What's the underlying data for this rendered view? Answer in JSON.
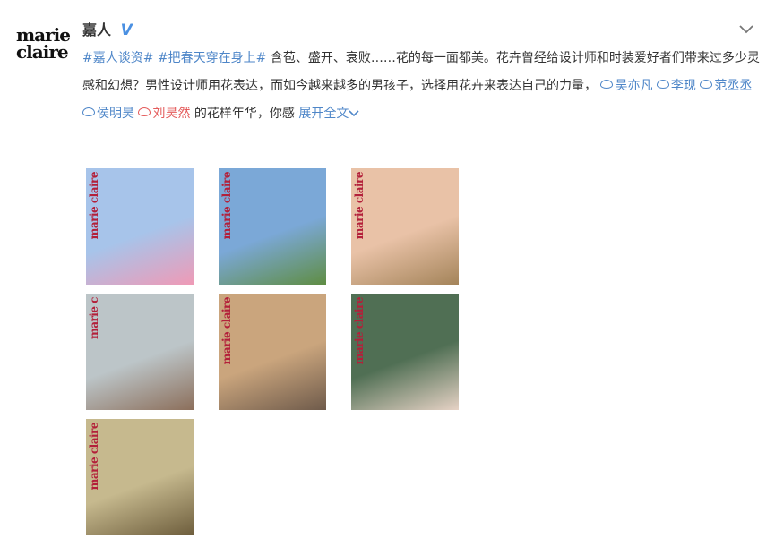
{
  "avatar": {
    "line1": "marie",
    "line2": "claire"
  },
  "user": {
    "name": "嘉人",
    "verified_mark": "V"
  },
  "post": {
    "tag1": "#嘉人谈资#",
    "tag2": "#把春天穿在身上#",
    "text1": " 含苞、盛开、衰败……花的每一面都美。花卉曾经给设计师和时装爱好者们带来过多少灵感和幻想？男性设计师用花表达，而如今越来越多的男孩子，选择用花卉来表达自己的力量，",
    "mentions": [
      {
        "name": "吴亦凡",
        "color": "#4e86c8"
      },
      {
        "name": "李现",
        "color": "#4e86c8"
      },
      {
        "name": "范丞丞",
        "color": "#4e86c8"
      },
      {
        "name": "侯明昊",
        "color": "#4e86c8"
      },
      {
        "name": "刘昊然",
        "color": "#e45c5c"
      }
    ],
    "text2": " 的花样年华，你感 ",
    "expand_label": "展开全文"
  },
  "photos": [
    {
      "logo": "marie claire",
      "bg": "#a7c4ea",
      "accent": "#ef9ab6"
    },
    {
      "logo": "marie claire",
      "bg": "#7ba8d7",
      "accent": "#5f8d43"
    },
    {
      "logo": "marie claire",
      "bg": "#e9c2a7",
      "accent": "#a4845a"
    },
    {
      "logo": "marie c",
      "bg": "#bcc5c8",
      "accent": "#8c6f5b"
    },
    {
      "logo": "marie claire",
      "bg": "#caa57d",
      "accent": "#6f5b4b"
    },
    {
      "logo": "marie claire",
      "bg": "#506f54",
      "accent": "#e6d2c5"
    },
    {
      "logo": "marie claire",
      "bg": "#c6b98e",
      "accent": "#6e5e3d"
    }
  ],
  "colors": {
    "link": "#4e86c8",
    "logo_red": "#b3203a"
  }
}
